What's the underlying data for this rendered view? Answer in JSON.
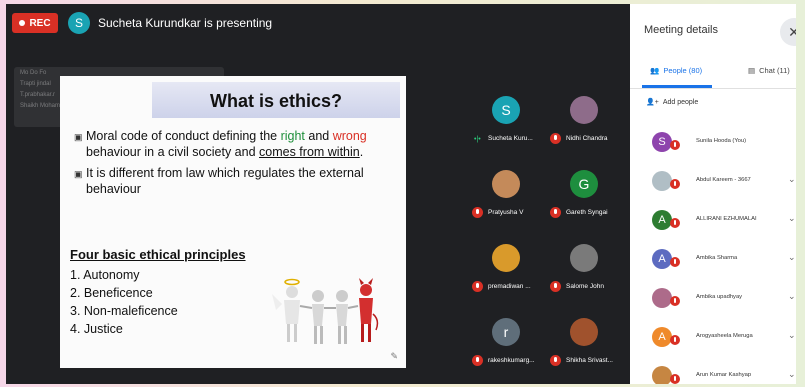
{
  "topbar": {
    "rec_label": "REC",
    "presenter_initial": "S",
    "presenting_text": "Sucheta Kurundkar is presenting"
  },
  "ghost_overlay": {
    "lines": [
      "Mo Do Fo",
      "Trapti jindal",
      "T.prabhakar.r",
      "Shaikh Mohammed ... unle"
    ]
  },
  "slide": {
    "title": "What is ethics?",
    "bullet1": {
      "pre": "Moral code of conduct defining the ",
      "w1": "right",
      "mid": " and ",
      "w2": "wrong",
      "post1": " behaviour in a civil society and ",
      "u": "comes from within",
      "post2": "."
    },
    "bullet2": "It is different from law which regulates the external behaviour",
    "principles_heading": "Four basic ethical principles",
    "principles": [
      "1. Autonomy",
      "2. Beneficence",
      "3. Non-maleficence",
      "4. Justice"
    ]
  },
  "tiles": [
    {
      "name": "Sucheta Kuru...",
      "initial": "S",
      "color": "#1aa3b3"
    },
    {
      "name": "Nidhi Chandra",
      "initial": "",
      "color": "#8e6c8a"
    },
    {
      "name": "Pratyusha V",
      "initial": "",
      "color": "#c48a5a"
    },
    {
      "name": "Gareth Syngai",
      "initial": "G",
      "color": "#1e8e3e"
    },
    {
      "name": "premadiwan ...",
      "initial": "",
      "color": "#d99a2b"
    },
    {
      "name": "Salome John",
      "initial": "",
      "color": "#7a7a7a"
    },
    {
      "name": "rakeshkumarg...",
      "initial": "r",
      "color": "#5f6e7a"
    },
    {
      "name": "Shikha Srivast...",
      "initial": "",
      "color": "#a0522d"
    }
  ],
  "panel": {
    "title": "Meeting details",
    "tab_people": "People (80)",
    "tab_chat": "Chat (11)",
    "add_people": "Add people",
    "people": [
      {
        "name": "Sunila Hooda (You)",
        "initial": "S",
        "color": "#8e44ad",
        "chevron": ""
      },
      {
        "name": "Abdul Kareem - 3667",
        "initial": "",
        "color": "#b0bec5",
        "chevron": "⌄"
      },
      {
        "name": "ALLIRANI EZHUMALAI",
        "initial": "A",
        "color": "#2e7d32",
        "chevron": "⌄"
      },
      {
        "name": "Ambika Sharma",
        "initial": "A",
        "color": "#5c6bc0",
        "chevron": "⌄"
      },
      {
        "name": "Ambika upadhyay",
        "initial": "",
        "color": "#ad6b8a",
        "chevron": "⌄"
      },
      {
        "name": "Arogyasheela Meruga",
        "initial": "A",
        "color": "#ef8a2b",
        "chevron": "⌄"
      },
      {
        "name": "Arun Kumar Kashyap",
        "initial": "",
        "color": "#c68642",
        "chevron": "⌄"
      }
    ]
  }
}
